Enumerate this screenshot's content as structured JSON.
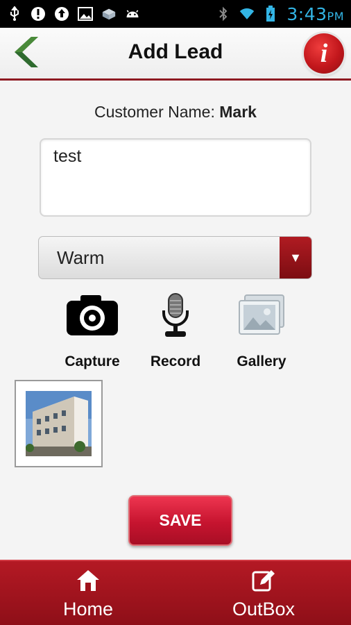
{
  "status_bar": {
    "left_icons": [
      "usb-icon",
      "alert-icon",
      "upload-icon",
      "image-icon",
      "package-icon",
      "android-icon"
    ],
    "right_icons": [
      "bluetooth-icon",
      "wifi-icon",
      "battery-icon"
    ],
    "time": "3:43",
    "ampm": "PM"
  },
  "header": {
    "title": "Add Lead",
    "back_icon": "chevron-left-icon",
    "info_label": "i"
  },
  "customer": {
    "label": "Customer Name:",
    "name": "Mark"
  },
  "notes": {
    "value": "test"
  },
  "lead_status": {
    "selected": "Warm",
    "arrow": "▼"
  },
  "media": {
    "capture_label": "Capture",
    "record_label": "Record",
    "gallery_label": "Gallery"
  },
  "attachment": {
    "type": "photo"
  },
  "actions": {
    "save_label": "SAVE"
  },
  "bottom_nav": {
    "home_label": "Home",
    "outbox_label": "OutBox"
  },
  "colors": {
    "brand_red": "#8e0f18",
    "accent_red": "#c6142f",
    "status_time": "#33b5e5"
  }
}
